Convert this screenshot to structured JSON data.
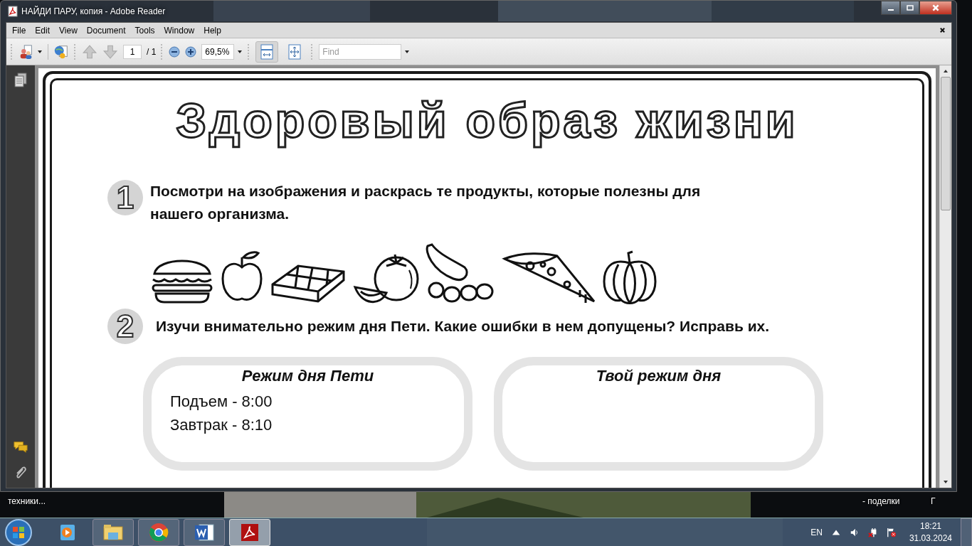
{
  "window": {
    "title": "НАЙДИ ПАРУ, копия - Adobe Reader"
  },
  "menu": [
    "File",
    "Edit",
    "View",
    "Document",
    "Tools",
    "Window",
    "Help"
  ],
  "toolbar": {
    "nav": [
      {
        "kind": "up",
        "disabled": true
      },
      {
        "kind": "down",
        "disabled": true
      }
    ],
    "page": "1",
    "page_total": "/ 1",
    "zoom": "69,5%",
    "view_buttons": [
      {
        "kind": "fit-width",
        "selected": true
      },
      {
        "kind": "fit-page",
        "selected": false
      }
    ],
    "find": {
      "placeholder": "Find"
    }
  },
  "document": {
    "title": "Здоровый образ жизни",
    "tasks": [
      {
        "number": "1",
        "text": "Посмотри на изображения и раскрась те продукты, которые полезны для нашего организма."
      },
      {
        "number": "2",
        "text": "Изучи внимательно режим дня Пети. Какие ошибки в нем допущены? Исправь их."
      }
    ],
    "schedules": [
      {
        "title": "Режим дня Пети",
        "lines": [
          "Подъем - 8:00",
          "Завтрак - 8:10"
        ]
      },
      {
        "title": "Твой режим дня"
      }
    ]
  },
  "desktop_icons": [
    "техники...",
    "- поделки",
    "Г"
  ],
  "taskbar": {
    "apps": [
      {
        "kind": "media",
        "selected": false
      },
      {
        "kind": "explorer",
        "selected": false
      },
      {
        "kind": "chrome",
        "selected": false
      },
      {
        "kind": "word",
        "selected": false
      },
      {
        "kind": "acrobat",
        "selected": true
      }
    ],
    "tray": {
      "language": "EN",
      "time": "18:21",
      "date": "31.03.2024"
    }
  }
}
